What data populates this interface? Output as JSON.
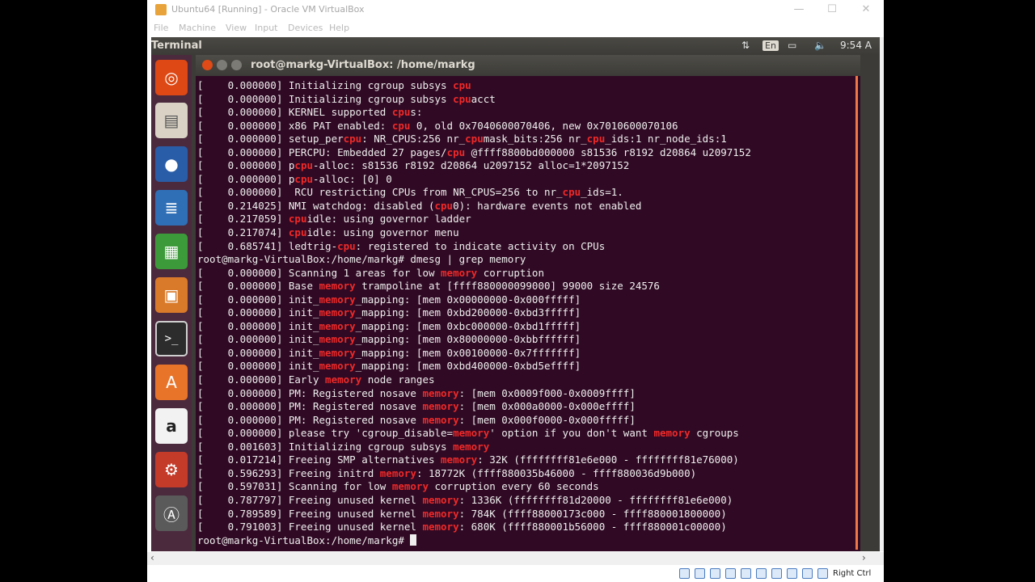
{
  "host": {
    "title": "Ubuntu64 [Running] - Oracle VM VirtualBox",
    "window_buttons": [
      "—",
      "☐",
      "✕"
    ],
    "menu": [
      "File",
      "Machine",
      "View",
      "Input",
      "Devices",
      "Help"
    ],
    "status_right": "Right Ctrl",
    "status_icons": [
      "hdd-icon",
      "optical-icon",
      "usb-icon",
      "network-icon",
      "shared-folder-icon",
      "display-icon",
      "video-capture-icon",
      "cpu-icon",
      "mouse-integration-icon",
      "keyboard-icon"
    ]
  },
  "guest": {
    "topbar_title": "Terminal",
    "indicators": {
      "keyboard": "En",
      "time": "9:54 A"
    },
    "launcher_icons": [
      "ubuntu-dash-icon",
      "files-icon",
      "firefox-icon",
      "writer-icon",
      "calc-icon",
      "impress-icon",
      "terminal-icon",
      "software-center-icon",
      "amazon-icon",
      "system-settings-icon",
      "updater-icon"
    ]
  },
  "terminal": {
    "title": "root@markg-VirtualBox: /home/markg",
    "lines": [
      [
        [
          "[    0.000000] Initializing cgroup subsys ",
          0
        ],
        [
          "cpu",
          1
        ]
      ],
      [
        [
          "[    0.000000] Initializing cgroup subsys ",
          0
        ],
        [
          "cpu",
          1
        ],
        [
          "acct",
          0
        ]
      ],
      [
        [
          "[    0.000000] KERNEL supported ",
          0
        ],
        [
          "cpu",
          1
        ],
        [
          "s:",
          0
        ]
      ],
      [
        [
          "[    0.000000] x86 PAT enabled: ",
          0
        ],
        [
          "cpu",
          1
        ],
        [
          " 0, old 0x7040600070406, new 0x7010600070106",
          0
        ]
      ],
      [
        [
          "[    0.000000] setup_per",
          0
        ],
        [
          "cpu",
          1
        ],
        [
          ": NR_CPUS:256 nr_",
          0
        ],
        [
          "cpu",
          1
        ],
        [
          "mask_bits:256 nr_",
          0
        ],
        [
          "cpu",
          1
        ],
        [
          "_ids:1 nr_node_ids:1",
          0
        ]
      ],
      [
        [
          "[    0.000000] PERCPU: Embedded 27 pages/",
          0
        ],
        [
          "cpu",
          1
        ],
        [
          " @ffff8800bd000000 s81536 r8192 d20864 u2097152",
          0
        ]
      ],
      [
        [
          "[    0.000000] p",
          0
        ],
        [
          "cpu",
          1
        ],
        [
          "-alloc: s81536 r8192 d20864 u2097152 alloc=1*2097152",
          0
        ]
      ],
      [
        [
          "[    0.000000] p",
          0
        ],
        [
          "cpu",
          1
        ],
        [
          "-alloc: [0] 0",
          0
        ]
      ],
      [
        [
          "[    0.000000]  RCU restricting CPUs from NR_CPUS=256 to nr_",
          0
        ],
        [
          "cpu",
          1
        ],
        [
          "_ids=1.",
          0
        ]
      ],
      [
        [
          "[    0.214025] NMI watchdog: disabled (",
          0
        ],
        [
          "cpu",
          1
        ],
        [
          "0): hardware events not enabled",
          0
        ]
      ],
      [
        [
          "[    0.217059] ",
          0
        ],
        [
          "cpu",
          1
        ],
        [
          "idle: using governor ladder",
          0
        ]
      ],
      [
        [
          "[    0.217074] ",
          0
        ],
        [
          "cpu",
          1
        ],
        [
          "idle: using governor menu",
          0
        ]
      ],
      [
        [
          "[    0.685741] ledtrig-",
          0
        ],
        [
          "cpu",
          1
        ],
        [
          ": registered to indicate activity on CPUs",
          0
        ]
      ],
      [
        [
          "root@markg-VirtualBox:/home/markg# dmesg | grep memory",
          0
        ]
      ],
      [
        [
          "[    0.000000] Scanning 1 areas for low ",
          0
        ],
        [
          "memory",
          1
        ],
        [
          " corruption",
          0
        ]
      ],
      [
        [
          "[    0.000000] Base ",
          0
        ],
        [
          "memory",
          1
        ],
        [
          " trampoline at [ffff880000099000] 99000 size 24576",
          0
        ]
      ],
      [
        [
          "[    0.000000] init_",
          0
        ],
        [
          "memory",
          1
        ],
        [
          "_mapping: [mem 0x00000000-0x000fffff]",
          0
        ]
      ],
      [
        [
          "[    0.000000] init_",
          0
        ],
        [
          "memory",
          1
        ],
        [
          "_mapping: [mem 0xbd200000-0xbd3fffff]",
          0
        ]
      ],
      [
        [
          "[    0.000000] init_",
          0
        ],
        [
          "memory",
          1
        ],
        [
          "_mapping: [mem 0xbc000000-0xbd1fffff]",
          0
        ]
      ],
      [
        [
          "[    0.000000] init_",
          0
        ],
        [
          "memory",
          1
        ],
        [
          "_mapping: [mem 0x80000000-0xbbffffff]",
          0
        ]
      ],
      [
        [
          "[    0.000000] init_",
          0
        ],
        [
          "memory",
          1
        ],
        [
          "_mapping: [mem 0x00100000-0x7fffffff]",
          0
        ]
      ],
      [
        [
          "[    0.000000] init_",
          0
        ],
        [
          "memory",
          1
        ],
        [
          "_mapping: [mem 0xbd400000-0xbd5effff]",
          0
        ]
      ],
      [
        [
          "[    0.000000] Early ",
          0
        ],
        [
          "memory",
          1
        ],
        [
          " node ranges",
          0
        ]
      ],
      [
        [
          "[    0.000000] PM: Registered nosave ",
          0
        ],
        [
          "memory",
          1
        ],
        [
          ": [mem 0x0009f000-0x0009ffff]",
          0
        ]
      ],
      [
        [
          "[    0.000000] PM: Registered nosave ",
          0
        ],
        [
          "memory",
          1
        ],
        [
          ": [mem 0x000a0000-0x000effff]",
          0
        ]
      ],
      [
        [
          "[    0.000000] PM: Registered nosave ",
          0
        ],
        [
          "memory",
          1
        ],
        [
          ": [mem 0x000f0000-0x000fffff]",
          0
        ]
      ],
      [
        [
          "[    0.000000] please try 'cgroup_disable=",
          0
        ],
        [
          "memory",
          1
        ],
        [
          "' option if you don't want ",
          0
        ],
        [
          "memory",
          1
        ],
        [
          " cgroups",
          0
        ]
      ],
      [
        [
          "[    0.001603] Initializing cgroup subsys ",
          0
        ],
        [
          "memory",
          1
        ]
      ],
      [
        [
          "[    0.017214] Freeing SMP alternatives ",
          0
        ],
        [
          "memory",
          1
        ],
        [
          ": 32K (ffffffff81e6e000 - ffffffff81e76000)",
          0
        ]
      ],
      [
        [
          "[    0.596293] Freeing initrd ",
          0
        ],
        [
          "memory",
          1
        ],
        [
          ": 18772K (ffff880035b46000 - ffff880036d9b000)",
          0
        ]
      ],
      [
        [
          "[    0.597031] Scanning for low ",
          0
        ],
        [
          "memory",
          1
        ],
        [
          " corruption every 60 seconds",
          0
        ]
      ],
      [
        [
          "[    0.787797] Freeing unused kernel ",
          0
        ],
        [
          "memory",
          1
        ],
        [
          ": 1336K (ffffffff81d20000 - ffffffff81e6e000)",
          0
        ]
      ],
      [
        [
          "[    0.789589] Freeing unused kernel ",
          0
        ],
        [
          "memory",
          1
        ],
        [
          ": 784K (ffff88000173c000 - ffff880001800000)",
          0
        ]
      ],
      [
        [
          "[    0.791003] Freeing unused kernel ",
          0
        ],
        [
          "memory",
          1
        ],
        [
          ": 680K (ffff880001b56000 - ffff880001c00000)",
          0
        ]
      ]
    ],
    "prompt": "root@markg-VirtualBox:/home/markg# "
  }
}
